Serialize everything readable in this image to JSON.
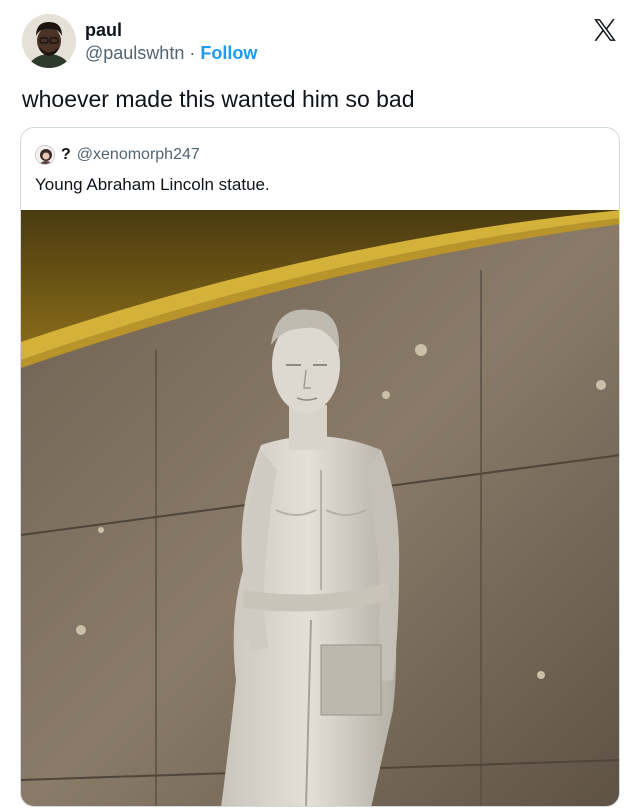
{
  "author": {
    "name": "paul",
    "handle": "@paulswhtn",
    "separator": "·",
    "follow_label": "Follow"
  },
  "tweet": {
    "text": "whoever made this wanted him so bad"
  },
  "quoted_tweet": {
    "name": "?",
    "handle": "@xenomorph247",
    "text": "Young Abraham Lincoln statue."
  },
  "icons": {
    "platform_logo": "x-logo-icon"
  },
  "colors": {
    "link_blue": "#1d9bf0",
    "secondary_text": "#536471",
    "primary_text": "#0f1419",
    "card_border": "#cfd9de"
  }
}
